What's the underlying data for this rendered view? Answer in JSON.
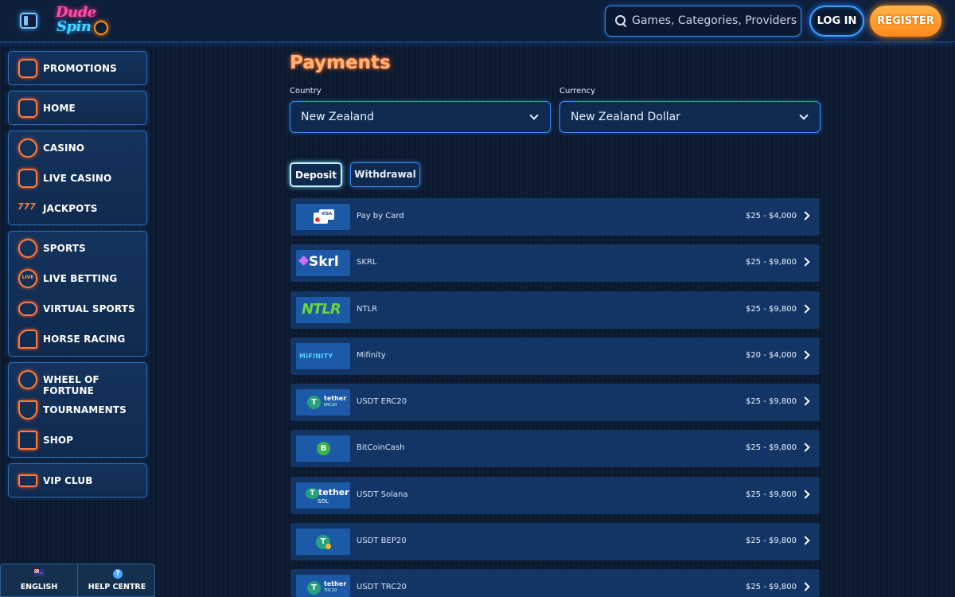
{
  "header": {
    "logo_line1": "Dude",
    "logo_line2": "Spin",
    "search_placeholder": "Games, Categories, Providers",
    "login_label": "LOG IN",
    "register_label": "REGISTER"
  },
  "sidebar": {
    "groups": [
      {
        "items": [
          {
            "label": "PROMOTIONS",
            "icon": "megaphone-icon"
          }
        ]
      },
      {
        "items": [
          {
            "label": "HOME",
            "icon": "home-icon"
          }
        ]
      },
      {
        "items": [
          {
            "label": "CASINO",
            "icon": "spade-icon"
          },
          {
            "label": "LIVE CASINO",
            "icon": "cards-icon"
          },
          {
            "label": "JACKPOTS",
            "icon": "sevens-icon"
          }
        ]
      },
      {
        "items": [
          {
            "label": "SPORTS",
            "icon": "ball-icon"
          },
          {
            "label": "LIVE BETTING",
            "icon": "live-icon"
          },
          {
            "label": "VIRTUAL SPORTS",
            "icon": "gamepad-icon"
          },
          {
            "label": "HORSE RACING",
            "icon": "horse-icon"
          }
        ]
      },
      {
        "items": [
          {
            "label": "WHEEL OF FORTUNE",
            "icon": "wheel-icon"
          },
          {
            "label": "TOURNAMENTS",
            "icon": "trophy-icon"
          },
          {
            "label": "SHOP",
            "icon": "bag-icon"
          }
        ]
      },
      {
        "items": [
          {
            "label": "VIP CLUB",
            "icon": "crown-icon"
          }
        ]
      }
    ]
  },
  "footer": {
    "language_label": "ENGLISH",
    "help_label": "HELP CENTRE",
    "help_glyph": "?"
  },
  "main": {
    "title": "Payments",
    "country_label": "Country",
    "country_value": "New Zealand",
    "currency_label": "Currency",
    "currency_value": "New Zealand Dollar",
    "tabs": {
      "deposit": "Deposit",
      "withdrawal": "Withdrawal"
    },
    "logo_text": {
      "visa": "VISA",
      "skrl": "Skrl",
      "ntlr": "NTLR",
      "mifinity": "MiFINITY",
      "tether": "tether",
      "erc20": "ERC20",
      "sol": "SOL",
      "trc20": "TRC20",
      "tether_glyph": "T",
      "bch_glyph": "B"
    },
    "methods": [
      {
        "name": "Pay by Card",
        "range": "$25 - $4,000"
      },
      {
        "name": "SKRL",
        "range": "$25 - $9,800"
      },
      {
        "name": "NTLR",
        "range": "$25 - $9,800"
      },
      {
        "name": "Mifinity",
        "range": "$20 - $4,000"
      },
      {
        "name": "USDT ERC20",
        "range": "$25 - $9,800"
      },
      {
        "name": "BitCoinCash",
        "range": "$25 - $9,800"
      },
      {
        "name": "USDT Solana",
        "range": "$25 - $9,800"
      },
      {
        "name": "USDT BEP20",
        "range": "$25 - $9,800"
      },
      {
        "name": "USDT TRC20",
        "range": "$25 - $9,800"
      }
    ]
  },
  "colors": {
    "accent_orange": "#ff8a1a",
    "accent_blue": "#3a8cff",
    "title_glow": "#ff6a1a",
    "background": "#0b1a30"
  }
}
